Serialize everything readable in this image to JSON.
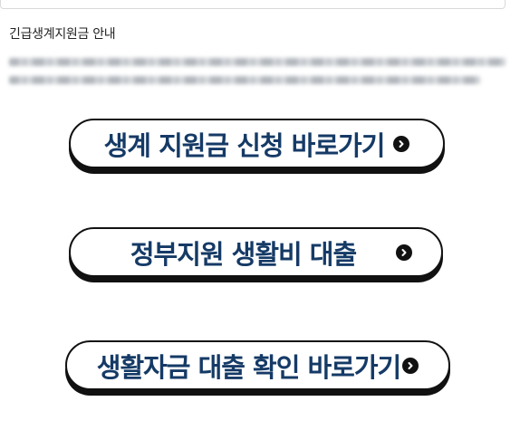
{
  "section": {
    "title": "긴급생계지원금 안내"
  },
  "buttons": [
    {
      "label": "생계 지원금 신청 바로가기",
      "icon": "chevron-right-circle-icon"
    },
    {
      "label": "정부지원 생활비 대출",
      "icon": "chevron-right-circle-icon"
    },
    {
      "label": "생활자금 대출 확인 바로가기",
      "icon": "chevron-right-circle-icon"
    }
  ],
  "colors": {
    "button_text": "#153a66",
    "button_border": "#111111",
    "background": "#ffffff"
  }
}
